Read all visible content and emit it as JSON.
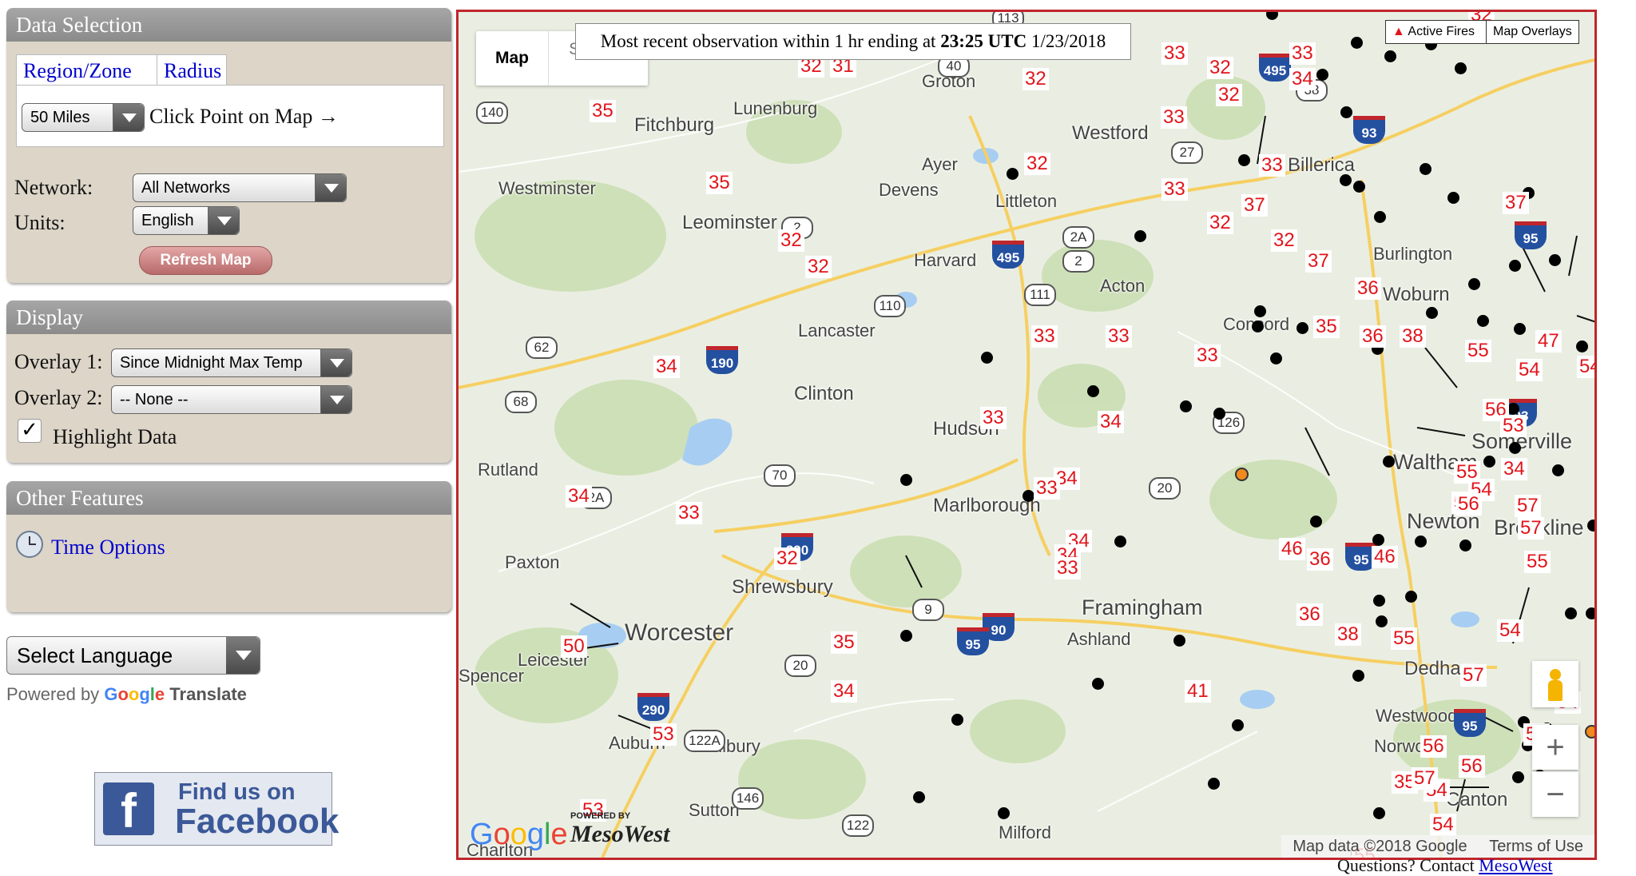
{
  "data_selection": {
    "title": "Data Selection",
    "tab_region": "Region/Zone",
    "tab_radius": "Radius",
    "radius_value": "50 Miles",
    "click_point_text": "Click Point on Map →",
    "network_label": "Network:",
    "network_value": "All Networks",
    "units_label": "Units:",
    "units_value": "English",
    "refresh_label": "Refresh Map"
  },
  "display": {
    "title": "Display",
    "overlay1_label": "Overlay 1:",
    "overlay1_value": "Since Midnight Max Temp",
    "overlay2_label": "Overlay 2:",
    "overlay2_value": "-- None --",
    "highlight_label": "Highlight Data"
  },
  "other_features": {
    "title": "Other Features",
    "time_options": "Time Options"
  },
  "language": {
    "select_label": "Select Language",
    "powered_by": "Powered by",
    "google": "Google",
    "translate": "Translate"
  },
  "facebook": {
    "line1": "Find us on",
    "line2": "Facebook"
  },
  "map": {
    "observation_prefix": "Most recent observation within 1 hr ending at",
    "observation_time": "23:25 UTC",
    "observation_date": "1/23/2018",
    "map_type_map": "Map",
    "map_type_satellite": "Satellite",
    "active_fires": "Active Fires",
    "map_overlays": "Map Overlays",
    "zoom_in": "+",
    "zoom_out": "−",
    "google_logo": "Google",
    "mesowest_powered": "POWERED BY",
    "mesowest_logo": "MesoWest",
    "map_data": "Map data ©2018 Google",
    "terms": "Terms of Use",
    "places": [
      {
        "name": "Groton",
        "size": 22
      },
      {
        "name": "Lunenburg",
        "size": 22
      },
      {
        "name": "Fitchburg",
        "size": 24
      },
      {
        "name": "Westford",
        "size": 24
      },
      {
        "name": "Billerica",
        "size": 24
      },
      {
        "name": "Ayer",
        "size": 22
      },
      {
        "name": "Westminster",
        "size": 22
      },
      {
        "name": "Devens",
        "size": 22
      },
      {
        "name": "Littleton",
        "size": 22
      },
      {
        "name": "Leominster",
        "size": 24
      },
      {
        "name": "Harvard",
        "size": 22
      },
      {
        "name": "Acton",
        "size": 22
      },
      {
        "name": "Burlington",
        "size": 22
      },
      {
        "name": "Woburn",
        "size": 24
      },
      {
        "name": "Concord",
        "size": 22
      },
      {
        "name": "Lancaster",
        "size": 22
      },
      {
        "name": "Clinton",
        "size": 24
      },
      {
        "name": "Hudson",
        "size": 24
      },
      {
        "name": "Somerville",
        "size": 27
      },
      {
        "name": "Rutland",
        "size": 22
      },
      {
        "name": "Waltham",
        "size": 27
      },
      {
        "name": "Marlborough",
        "size": 24
      },
      {
        "name": "Newton",
        "size": 27
      },
      {
        "name": "Brookline",
        "size": 27
      },
      {
        "name": "Paxton",
        "size": 22
      },
      {
        "name": "Shrewsbury",
        "size": 24
      },
      {
        "name": "Framingham",
        "size": 27
      },
      {
        "name": "Worcester",
        "size": 30
      },
      {
        "name": "Ashland",
        "size": 22
      },
      {
        "name": "Leicester",
        "size": 22
      },
      {
        "name": "Dedham",
        "size": 24
      },
      {
        "name": "Westwood",
        "size": 22
      },
      {
        "name": "Norwood",
        "size": 22
      },
      {
        "name": "Auburn",
        "size": 22
      },
      {
        "name": "Millbury",
        "size": 22
      },
      {
        "name": "Sutton",
        "size": 22
      },
      {
        "name": "Canton",
        "size": 24
      },
      {
        "name": "Milford",
        "size": 22
      },
      {
        "name": "Charlton",
        "size": 22
      },
      {
        "name": "Spencer",
        "size": 22
      }
    ],
    "station_values": [
      "32",
      "32",
      "31",
      "33",
      "33",
      "32",
      "32",
      "34",
      "35",
      "32",
      "33",
      "35",
      "33",
      "32",
      "33",
      "32",
      "37",
      "37",
      "32",
      "32",
      "32",
      "37",
      "36",
      "35",
      "36",
      "38",
      "33",
      "33",
      "33",
      "34",
      "33",
      "55",
      "47",
      "54",
      "54",
      "34",
      "34",
      "56",
      "53",
      "34",
      "33",
      "55",
      "54",
      "56",
      "57",
      "34",
      "33",
      "56",
      "34",
      "32",
      "34",
      "36",
      "46",
      "46",
      "57",
      "55",
      "33",
      "36",
      "38",
      "35",
      "50",
      "55",
      "54",
      "57",
      "56",
      "34",
      "41",
      "53",
      "54",
      "56",
      "53",
      "54",
      "35",
      "57",
      "54",
      "55",
      "56"
    ],
    "shields": [
      {
        "num": "113",
        "kind": "state"
      },
      {
        "num": "40",
        "kind": "state"
      },
      {
        "num": "38",
        "kind": "state"
      },
      {
        "num": "140",
        "kind": "state"
      },
      {
        "num": "495",
        "kind": "inter"
      },
      {
        "num": "93",
        "kind": "inter"
      },
      {
        "num": "27",
        "kind": "state"
      },
      {
        "num": "2",
        "kind": "state"
      },
      {
        "num": "2A",
        "kind": "state"
      },
      {
        "num": "95",
        "kind": "inter"
      },
      {
        "num": "495",
        "kind": "inter"
      },
      {
        "num": "2",
        "kind": "state"
      },
      {
        "num": "111",
        "kind": "state"
      },
      {
        "num": "110",
        "kind": "state"
      },
      {
        "num": "62",
        "kind": "state"
      },
      {
        "num": "190",
        "kind": "inter"
      },
      {
        "num": "68",
        "kind": "state"
      },
      {
        "num": "126",
        "kind": "state"
      },
      {
        "num": "93",
        "kind": "inter"
      },
      {
        "num": "70",
        "kind": "state"
      },
      {
        "num": "2A",
        "kind": "state"
      },
      {
        "num": "20",
        "kind": "state"
      },
      {
        "num": "290",
        "kind": "inter"
      },
      {
        "num": "95",
        "kind": "inter"
      },
      {
        "num": "9",
        "kind": "state"
      },
      {
        "num": "90",
        "kind": "inter"
      },
      {
        "num": "95",
        "kind": "inter"
      },
      {
        "num": "20",
        "kind": "state"
      },
      {
        "num": "290",
        "kind": "inter"
      },
      {
        "num": "122A",
        "kind": "state"
      },
      {
        "num": "95",
        "kind": "inter"
      },
      {
        "num": "146",
        "kind": "state"
      },
      {
        "num": "122",
        "kind": "state"
      }
    ]
  },
  "footer": {
    "questions": "Questions? Contact",
    "contact_link": "MesoWest"
  }
}
